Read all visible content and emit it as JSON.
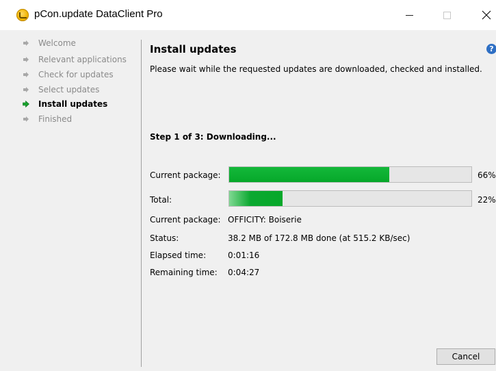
{
  "window": {
    "title": "pCon.update DataClient Pro"
  },
  "nav": {
    "items": [
      {
        "label": "Welcome",
        "active": false
      },
      {
        "label": "Relevant applications",
        "active": false
      },
      {
        "label": "Check for updates",
        "active": false
      },
      {
        "label": "Select updates",
        "active": false
      },
      {
        "label": "Install updates",
        "active": true
      },
      {
        "label": "Finished",
        "active": false
      }
    ]
  },
  "main": {
    "heading": "Install updates",
    "help_icon": "question-circle-icon",
    "description": "Please wait while the requested updates are downloaded, checked and installed.",
    "step": "Step 1 of 3: Downloading...",
    "current_package_label": "Current package:",
    "current_package_percent": "66%",
    "current_package_progress": 0.66,
    "total_label": "Total:",
    "total_percent": "22%",
    "total_progress": 0.22,
    "info": {
      "package_label": "Current package:",
      "package_value": "OFFICITY: Boiserie",
      "status_label": "Status:",
      "status_value": "38.2 MB of 172.8 MB done (at 515.2 KB/sec)",
      "elapsed_label": "Elapsed time:",
      "elapsed_value": "0:01:16",
      "remaining_label": "Remaining time:",
      "remaining_value": "0:04:27"
    },
    "cancel_label": "Cancel"
  },
  "colors": {
    "progress_green": "#06a82a",
    "active_arrow": "#1aa32e",
    "inactive_arrow": "#9a9a9a",
    "help_blue": "#2e6fc4"
  }
}
